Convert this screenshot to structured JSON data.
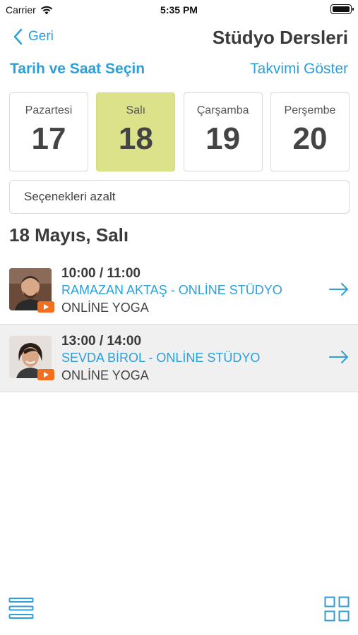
{
  "status_bar": {
    "carrier": "Carrier",
    "time": "5:35 PM"
  },
  "nav": {
    "back_label": "Geri",
    "title": "Stüdyo Dersleri"
  },
  "subheader": {
    "left": "Tarih ve Saat Seçin",
    "right": "Takvimi Göster"
  },
  "days": [
    {
      "name": "Pazartesi",
      "number": "17"
    },
    {
      "name": "Salı",
      "number": "18",
      "selected": true
    },
    {
      "name": "Çarşamba",
      "number": "19"
    },
    {
      "name": "Perşembe",
      "number": "20"
    }
  ],
  "filter_label": "Seçenekleri azalt",
  "date_heading": "18 Mayıs, Salı",
  "classes": [
    {
      "time": "10:00 / 11:00",
      "trainer": "RAMAZAN AKTAŞ - ONLİNE STÜDYO",
      "class_name": "ONLİNE YOGA"
    },
    {
      "time": "13:00 / 14:00",
      "trainer": "SEVDA BİROL - ONLİNE STÜDYO",
      "class_name": "ONLİNE YOGA"
    }
  ],
  "colors": {
    "accent": "#2d9fd9",
    "selected_day": "#dbe28a",
    "badge": "#f07020"
  },
  "icons": {
    "back": "chevron-left-icon",
    "row_arrow": "arrow-right-icon",
    "bottom_left": "list-icon",
    "bottom_right": "grid-icon",
    "wifi": "wifi-icon",
    "battery": "battery-icon",
    "video": "video-play-icon"
  }
}
